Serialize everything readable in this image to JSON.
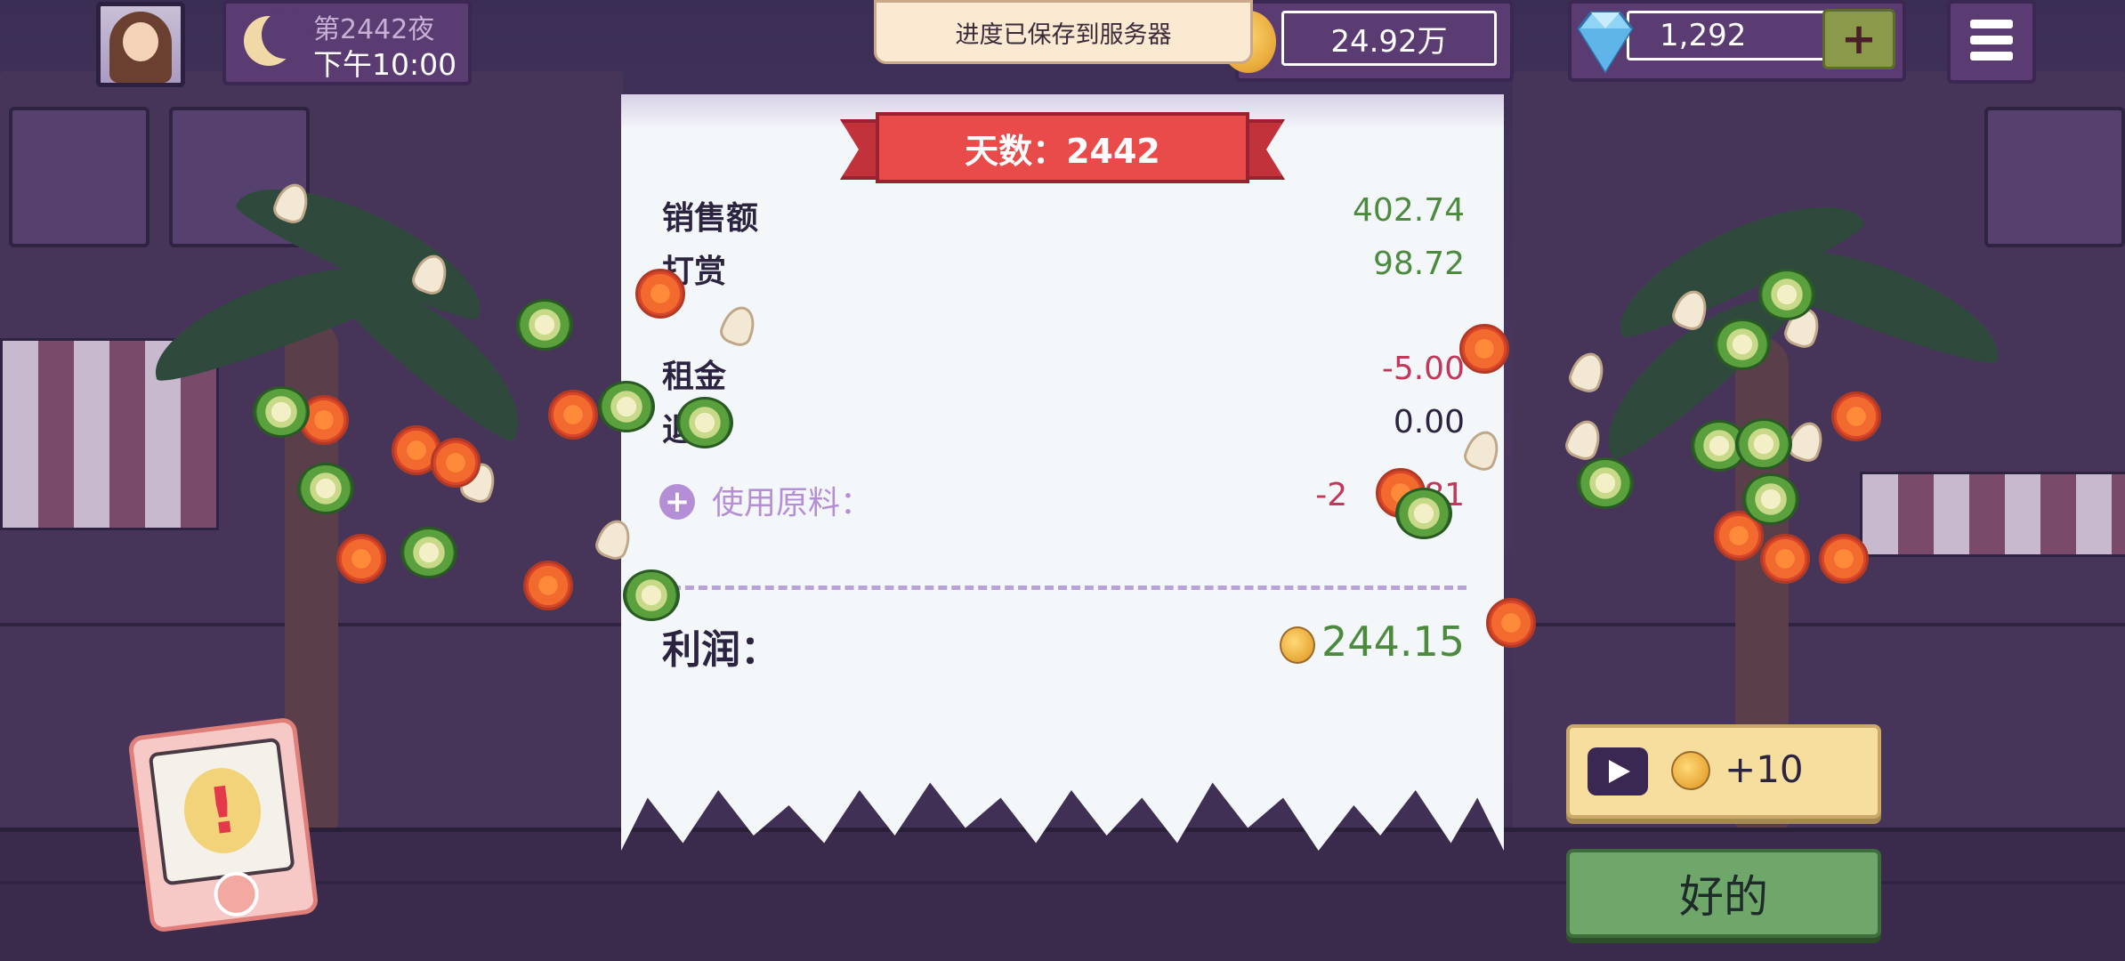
{
  "hud": {
    "night_label": "第2442夜",
    "time": "下午10:00",
    "toast": "进度已保存到服务器",
    "coins": "24.92万",
    "gems": "1,292",
    "gem_plus": "+"
  },
  "receipt": {
    "banner": "天数：2442",
    "rows": [
      {
        "label": "销售额",
        "value": "402.74"
      },
      {
        "label": "打赏",
        "value": "98.72"
      },
      {
        "label": "租金",
        "value": "-5.00"
      },
      {
        "label": "退",
        "value": "0.00"
      }
    ],
    "ingredients_label": "使用原料：",
    "ingredients_value": "-2",
    "ingredients_value_tail": "81",
    "profit_label": "利润：",
    "profit_value": "244.15"
  },
  "buttons": {
    "video_reward": "+10",
    "ok": "好的"
  },
  "alert": {
    "symbol": "!"
  },
  "colors": {
    "positive": "#4c8a3e",
    "negative": "#c2385a",
    "ok_button": "#6fa76a",
    "video_button": "#f6df9e",
    "banner": "#e94a4a"
  },
  "icons": [
    "moon-icon",
    "coin-icon",
    "gem-icon",
    "plus-icon",
    "menu-icon",
    "play-icon",
    "alert-icon"
  ]
}
